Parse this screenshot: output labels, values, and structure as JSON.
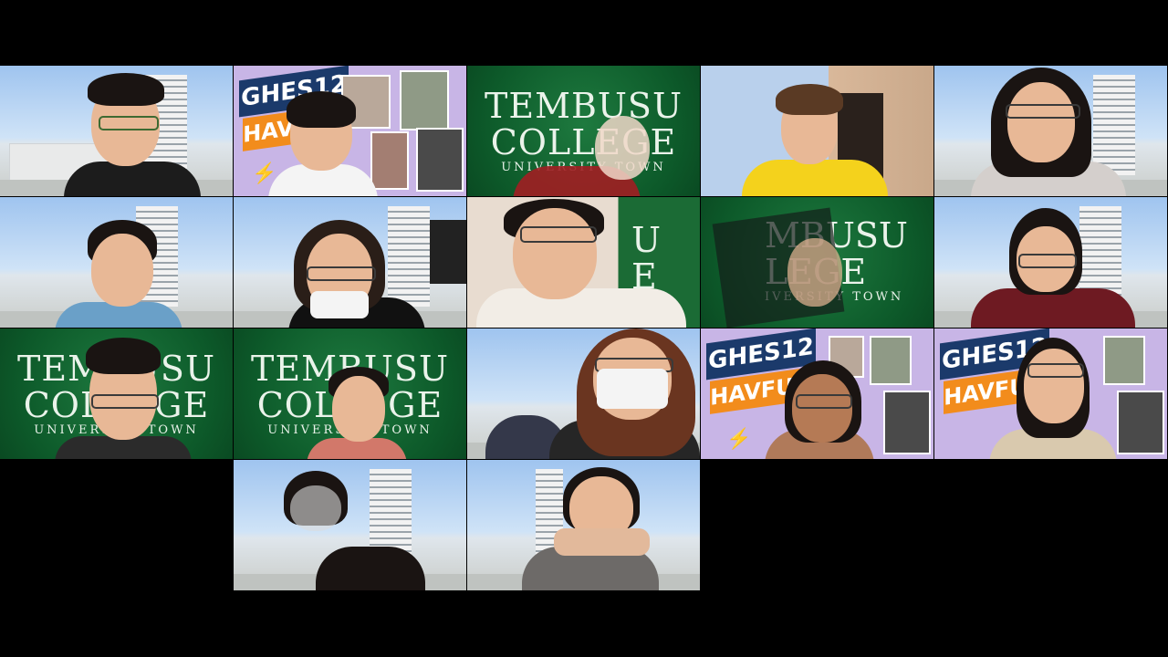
{
  "college_background": {
    "line1": "TEMBUSU",
    "line2": "COLLEGE",
    "line3": "UNIVERSITY TOWN"
  },
  "event_background": {
    "line1": "GHES12",
    "line2": "HAVFUN"
  },
  "gallery": {
    "columns": 5,
    "rows": 4,
    "tile_count": 17
  },
  "colors": {
    "background": "#000000",
    "college_green": "#0d5a2a",
    "event_lavender": "#c8b5e6",
    "event_navy": "#1b3a6b",
    "event_orange": "#f28c1c"
  }
}
